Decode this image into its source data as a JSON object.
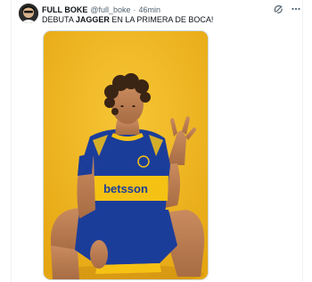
{
  "author": {
    "display_name": "FULL BOKE",
    "handle": "@full_boke",
    "separator": "·",
    "time_ago": "46min"
  },
  "tweet": {
    "text_before": "DEBUTA ",
    "text_bold": "JAGGER",
    "text_after": " EN LA PRIMERA DE BOCA!"
  },
  "icons": {
    "grok": "grok-icon",
    "more": "more-icon"
  },
  "media": {
    "jersey_text": "betsson",
    "colors": {
      "background": "#f2b61e",
      "jersey_blue": "#1b3d9a",
      "jersey_yellow": "#f5c214"
    }
  }
}
